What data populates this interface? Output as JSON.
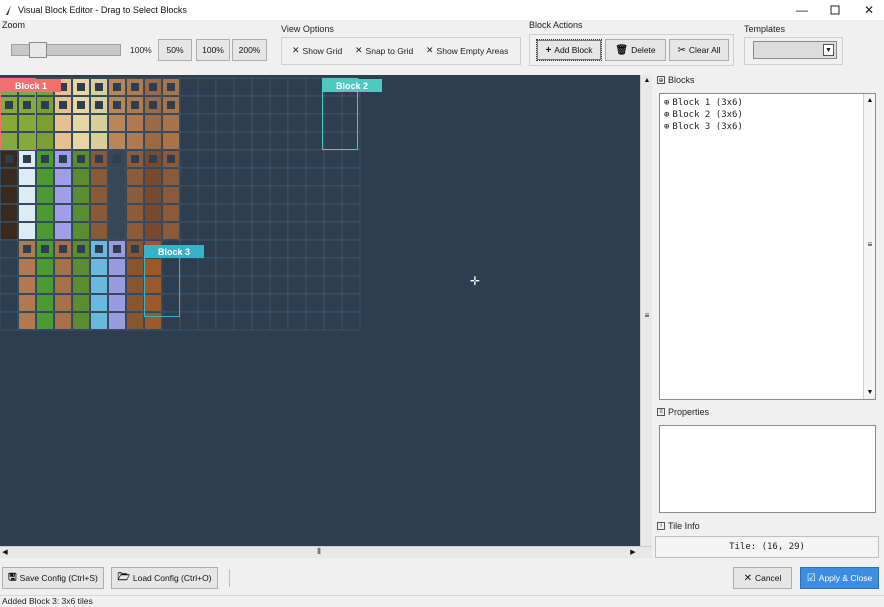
{
  "window": {
    "title": "Visual Block Editor - Drag to Select Blocks"
  },
  "zoom": {
    "label": "Zoom",
    "value_text": "100%",
    "slider_value_percent": 100,
    "presets": [
      "50%",
      "100%",
      "200%"
    ]
  },
  "view_options": {
    "label": "View Options",
    "show_grid": "Show Grid",
    "snap_to_grid": "Snap to Grid",
    "show_empty": "Show Empty Areas"
  },
  "block_actions": {
    "label": "Block Actions",
    "add": "Add Block",
    "delete": "Delete",
    "clear": "Clear All"
  },
  "templates": {
    "label": "Templates",
    "selected": ""
  },
  "colors": {
    "canvas_bg": "#2c3e50",
    "block1": "#f07070",
    "block2": "#4ec9c0",
    "block3": "#38b2c8",
    "accent": "#3c8ee0"
  },
  "blocks_panel": {
    "title": "Blocks",
    "items": [
      "Block 1 (3x6)",
      "Block 2 (3x6)",
      "Block 3 (3x6)"
    ]
  },
  "canvas": {
    "block_labels": [
      "Block 1",
      "Block 2",
      "Block 3"
    ]
  },
  "properties_panel": {
    "title": "Properties"
  },
  "tile_info": {
    "title": "Tile Info",
    "value": "Tile: (16, 29)"
  },
  "bottom": {
    "save": "Save Config (Ctrl+S)",
    "load": "Load Config (Ctrl+O)",
    "cancel": "Cancel",
    "apply": "Apply & Close"
  },
  "status": "Added Block 3: 3x6 tiles"
}
